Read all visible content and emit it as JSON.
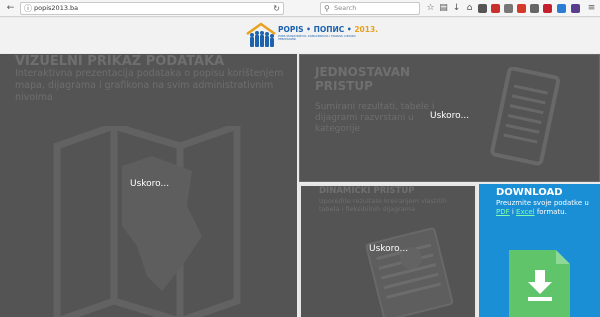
{
  "browser": {
    "url": "popis2013.ba",
    "search_placeholder": "Search"
  },
  "header": {
    "logo_title": "POPIS • ПОПИС • ",
    "logo_year": "2013.",
    "logo_subtitle": "POPIS STANOVNIŠTVA, DOMAĆINSTAVA I STANOVA U BOSNI I HERCEGOVINI"
  },
  "panels": {
    "visual": {
      "title": "VIZUELNI PRIKAZ PODATAKA",
      "desc": "Interaktivna prezentacija podataka o popisu korištenjem mapa, dijagrama i grafikona na svim administrativnim nivoima",
      "overlay": "Uskoro..."
    },
    "jednostavan": {
      "title_1": "JEDNOSTAVAN",
      "title_2": "PRISTUP",
      "desc": "Sumirani rezultati, tabele i dijagrami razvrstani u kategorije",
      "overlay": "Uskoro..."
    },
    "dinamicki": {
      "title": "DINAMIČKI PRISTUP",
      "desc": "Upoređite rezultate kreiranjem vlastitih tabela i fleksibilnih dijagrama",
      "overlay": "Uskoro..."
    },
    "download": {
      "title": "DOWNLOAD",
      "desc_before": "Preuzmite svoje podatke u ",
      "pdf_label": "PDF",
      "desc_mid": " i ",
      "excel_label": "Excel",
      "desc_after": " formatu."
    }
  },
  "icons": {
    "back": "back-arrow-icon",
    "info": "info-icon",
    "reload": "reload-icon",
    "search": "search-icon",
    "download": "download-arrow-icon"
  },
  "colors": {
    "panel_bg": "#545454",
    "download_bg": "#1b8fd6",
    "logo_blue": "#1c62ae",
    "logo_orange": "#e8a11e"
  }
}
